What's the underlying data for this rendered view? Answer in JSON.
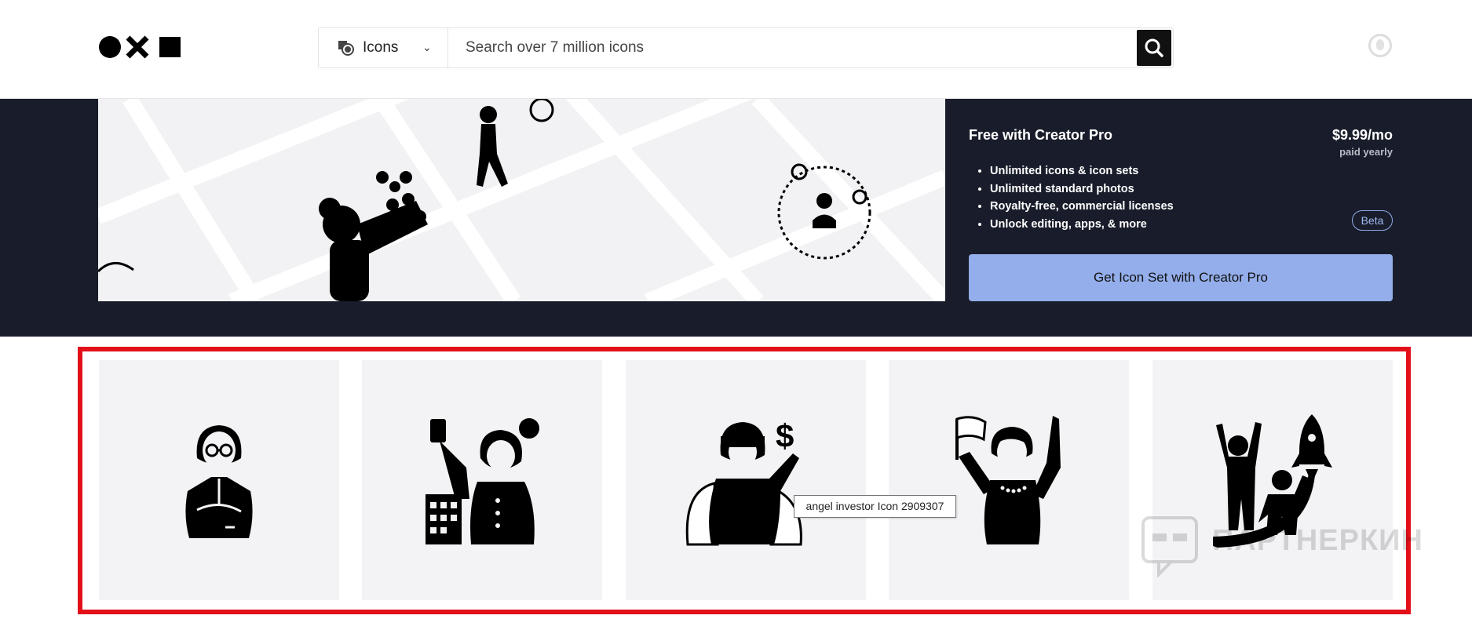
{
  "header": {
    "search_type_label": "Icons",
    "search_placeholder": "Search over 7 million icons"
  },
  "promo": {
    "title": "Free with Creator Pro",
    "price": "$9.99/mo",
    "period": "paid yearly",
    "features": [
      "Unlimited icons & icon sets",
      "Unlimited standard photos",
      "Royalty-free, commercial licenses",
      "Unlock editing, apps, & more"
    ],
    "beta_badge": "Beta",
    "cta_label": "Get Icon Set with Creator Pro"
  },
  "tiles": [
    {
      "icon": "businesswoman-crossed-arms-icon"
    },
    {
      "icon": "woman-holding-money-building-icon"
    },
    {
      "icon": "angel-investor-icon"
    },
    {
      "icon": "woman-with-flag-icon"
    },
    {
      "icon": "rocket-growth-people-icon"
    }
  ],
  "tooltip": "angel investor Icon 2909307",
  "watermark": "ПАРТНЕРКИН",
  "colors": {
    "band": "#191d2b",
    "cta": "#93aeea",
    "highlight": "#e3101a",
    "tile": "#f3f3f5"
  }
}
